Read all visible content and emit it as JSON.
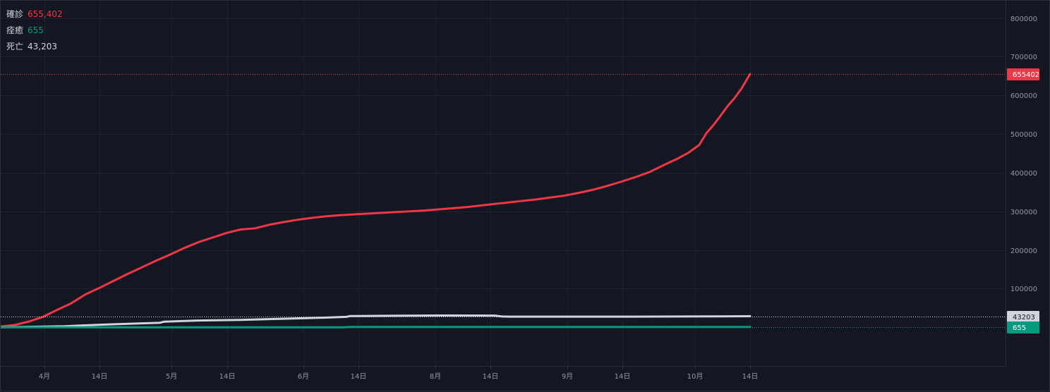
{
  "legend": [
    {
      "label": "確診",
      "value": "655,402",
      "color": "#f23645"
    },
    {
      "label": "痊癒",
      "value": "655",
      "color": "#089981"
    },
    {
      "label": "死亡",
      "value": "43,203",
      "color": "#d1d4dc"
    }
  ],
  "colors": {
    "background": "#131722",
    "grid": "#1e222d",
    "axis_text": "#9598a1",
    "border": "#2a2e39"
  },
  "chart_data": {
    "type": "line",
    "x_ticks": [
      "4月",
      "14日",
      "5月",
      "14日",
      "6月",
      "14日",
      "8月",
      "14日",
      "9月",
      "14日",
      "10月",
      "14日"
    ],
    "y_ticks": [
      "100000",
      "200000",
      "300000",
      "400000",
      "500000",
      "600000",
      "700000",
      "800000"
    ],
    "ylim": [
      -100000,
      845000
    ],
    "x_range": [
      0,
      1424
    ],
    "grid": true,
    "last_value_labels": [
      {
        "series": "確診",
        "text": "655402",
        "value": 655402,
        "bg": "#f23645",
        "fg": "#ffffff",
        "line": "#f23645"
      },
      {
        "series": "死亡",
        "text": "43203",
        "value": 43203,
        "bg": "#d1d4dc",
        "fg": "#131722",
        "line": "#d1d4dc"
      },
      {
        "series": "痊癒",
        "text": "655",
        "value": 655,
        "bg": "#089981",
        "fg": "#ffffff",
        "line": "#089981"
      }
    ],
    "series": [
      {
        "name": "確診",
        "color": "#f23645",
        "points": [
          [
            0,
            2000
          ],
          [
            20,
            6000
          ],
          [
            40,
            15000
          ],
          [
            60,
            27000
          ],
          [
            80,
            45000
          ],
          [
            100,
            62000
          ],
          [
            120,
            85000
          ],
          [
            140,
            102000
          ],
          [
            160,
            120000
          ],
          [
            180,
            138000
          ],
          [
            200,
            155000
          ],
          [
            220,
            172000
          ],
          [
            240,
            188000
          ],
          [
            260,
            205000
          ],
          [
            280,
            220000
          ],
          [
            300,
            232000
          ],
          [
            320,
            244000
          ],
          [
            340,
            253000
          ],
          [
            360,
            256000
          ],
          [
            380,
            265000
          ],
          [
            400,
            272000
          ],
          [
            420,
            278000
          ],
          [
            440,
            283000
          ],
          [
            460,
            287000
          ],
          [
            480,
            290000
          ],
          [
            500,
            292000
          ],
          [
            520,
            294000
          ],
          [
            540,
            296000
          ],
          [
            560,
            298000
          ],
          [
            580,
            300000
          ],
          [
            600,
            302000
          ],
          [
            620,
            305000
          ],
          [
            640,
            308000
          ],
          [
            660,
            311000
          ],
          [
            680,
            315000
          ],
          [
            700,
            319000
          ],
          [
            720,
            323000
          ],
          [
            740,
            327000
          ],
          [
            760,
            331000
          ],
          [
            780,
            336000
          ],
          [
            800,
            341000
          ],
          [
            820,
            348000
          ],
          [
            840,
            356000
          ],
          [
            860,
            366000
          ],
          [
            880,
            377000
          ],
          [
            900,
            389000
          ],
          [
            920,
            402000
          ],
          [
            940,
            420000
          ],
          [
            960,
            437000
          ],
          [
            975,
            452000
          ],
          [
            990,
            472000
          ],
          [
            1000,
            502000
          ],
          [
            1010,
            523000
          ],
          [
            1020,
            547000
          ],
          [
            1030,
            572000
          ],
          [
            1040,
            593000
          ],
          [
            1050,
            618000
          ],
          [
            1062,
            655402
          ]
        ]
      },
      {
        "name": "死亡",
        "color": "#d1d4dc",
        "points": [
          [
            0,
            0
          ],
          [
            40,
            1000
          ],
          [
            90,
            2500
          ],
          [
            140,
            6500
          ],
          [
            180,
            9000
          ],
          [
            225,
            11500
          ],
          [
            232,
            14500
          ],
          [
            280,
            17500
          ],
          [
            340,
            19000
          ],
          [
            400,
            22000
          ],
          [
            460,
            25000
          ],
          [
            490,
            27000
          ],
          [
            495,
            29000
          ],
          [
            550,
            29800
          ],
          [
            620,
            30500
          ],
          [
            700,
            30200
          ],
          [
            710,
            27800
          ],
          [
            720,
            27600
          ],
          [
            800,
            27500
          ],
          [
            900,
            27600
          ],
          [
            1000,
            28000
          ],
          [
            1062,
            28600
          ]
        ]
      },
      {
        "name": "痊癒",
        "color": "#089981",
        "points": [
          [
            0,
            0
          ],
          [
            200,
            0
          ],
          [
            485,
            0
          ],
          [
            495,
            655
          ],
          [
            1062,
            655
          ]
        ]
      }
    ]
  }
}
